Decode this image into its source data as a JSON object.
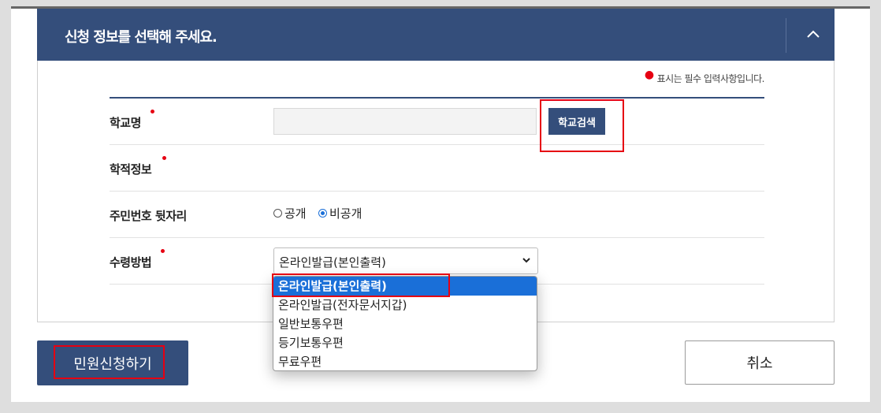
{
  "panel": {
    "title": "신청 정보를 선택해 주세요."
  },
  "required_note": "표시는 필수 입력사항입니다.",
  "form": {
    "school": {
      "label": "학교명",
      "input_value": "",
      "search_button": "학교검색"
    },
    "academic": {
      "label": "학적정보"
    },
    "rrn_suffix": {
      "label": "주민번호 뒷자리",
      "options": [
        "공개",
        "비공개"
      ],
      "selected": "비공개"
    },
    "delivery": {
      "label": "수령방법",
      "selected": "온라인발급(본인출력)",
      "options": [
        "온라인발급(본인출력)",
        "온라인발급(전자문서지갑)",
        "일반보통우편",
        "등기보통우편",
        "무료우편"
      ]
    }
  },
  "buttons": {
    "apply": "민원신청하기",
    "cancel": "취소"
  },
  "colors": {
    "header": "#344e7b",
    "required_dot": "#e60012",
    "highlight": "#e60012",
    "option_selected": "#1a6fd8"
  }
}
